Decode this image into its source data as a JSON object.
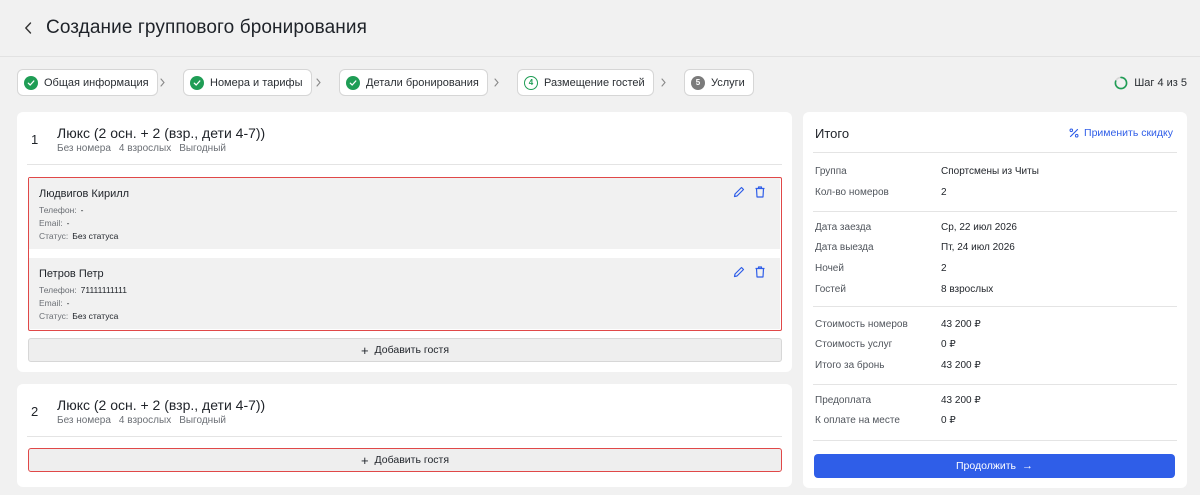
{
  "header": {
    "title": "Создание группового бронирования"
  },
  "stepper": {
    "steps": [
      {
        "num": "",
        "label": "Общая информация",
        "state": "done"
      },
      {
        "num": "",
        "label": "Номера и тарифы",
        "state": "done"
      },
      {
        "num": "",
        "label": "Детали бронирования",
        "state": "done"
      },
      {
        "num": "4",
        "label": "Размещение гостей",
        "state": "current"
      },
      {
        "num": "5",
        "label": "Услуги",
        "state": "todo"
      }
    ],
    "progress_label": "Шаг 4 из 5",
    "progress_fraction": 0.8
  },
  "rooms": [
    {
      "num": "1",
      "name": "Люкс (2 осн. + 2 (взр., дети 4-7))",
      "meta": [
        "Без номера",
        "4 взрослых",
        "Выгодный"
      ],
      "guests": [
        {
          "name": "Людвигов Кирилл",
          "phone_label": "Телефон:",
          "phone": "-",
          "email_label": "Email:",
          "email": "-",
          "status_label": "Статус:",
          "status": "Без статуса"
        },
        {
          "name": "Петров Петр",
          "phone_label": "Телефон:",
          "phone": "71111111111",
          "email_label": "Email:",
          "email": "-",
          "status_label": "Статус:",
          "status": "Без статуса"
        }
      ],
      "add_guest_label": "Добавить гостя"
    },
    {
      "num": "2",
      "name": "Люкс (2 осн. + 2 (взр., дети 4-7))",
      "meta": [
        "Без номера",
        "4 взрослых",
        "Выгодный"
      ],
      "guests": [],
      "add_guest_label": "Добавить гостя"
    }
  ],
  "summary": {
    "title": "Итого",
    "discount_label": "Применить скидку",
    "rows": [
      {
        "k": "Группа",
        "v": "Спортсмены из Читы"
      },
      {
        "k": "Кол-во номеров",
        "v": "2"
      },
      {
        "k": "Дата заезда",
        "v": "Ср, 22 июл 2026"
      },
      {
        "k": "Дата выезда",
        "v": "Пт, 24 июл 2026"
      },
      {
        "k": "Ночей",
        "v": "2"
      },
      {
        "k": "Гостей",
        "v": "8 взрослых"
      },
      {
        "k": "Стоимость номеров",
        "v": "43 200 ₽"
      },
      {
        "k": "Стоимость услуг",
        "v": "0 ₽"
      },
      {
        "k": "Итого за бронь",
        "v": "43 200 ₽"
      },
      {
        "k": "Предоплата",
        "v": "43 200 ₽"
      },
      {
        "k": "К оплате на месте",
        "v": "0 ₽"
      }
    ],
    "continue_label": "Продолжить",
    "continue_arrow": "→"
  },
  "colors": {
    "accent": "#2f5ee8",
    "done": "#1f9d55",
    "highlight": "#e04848"
  }
}
